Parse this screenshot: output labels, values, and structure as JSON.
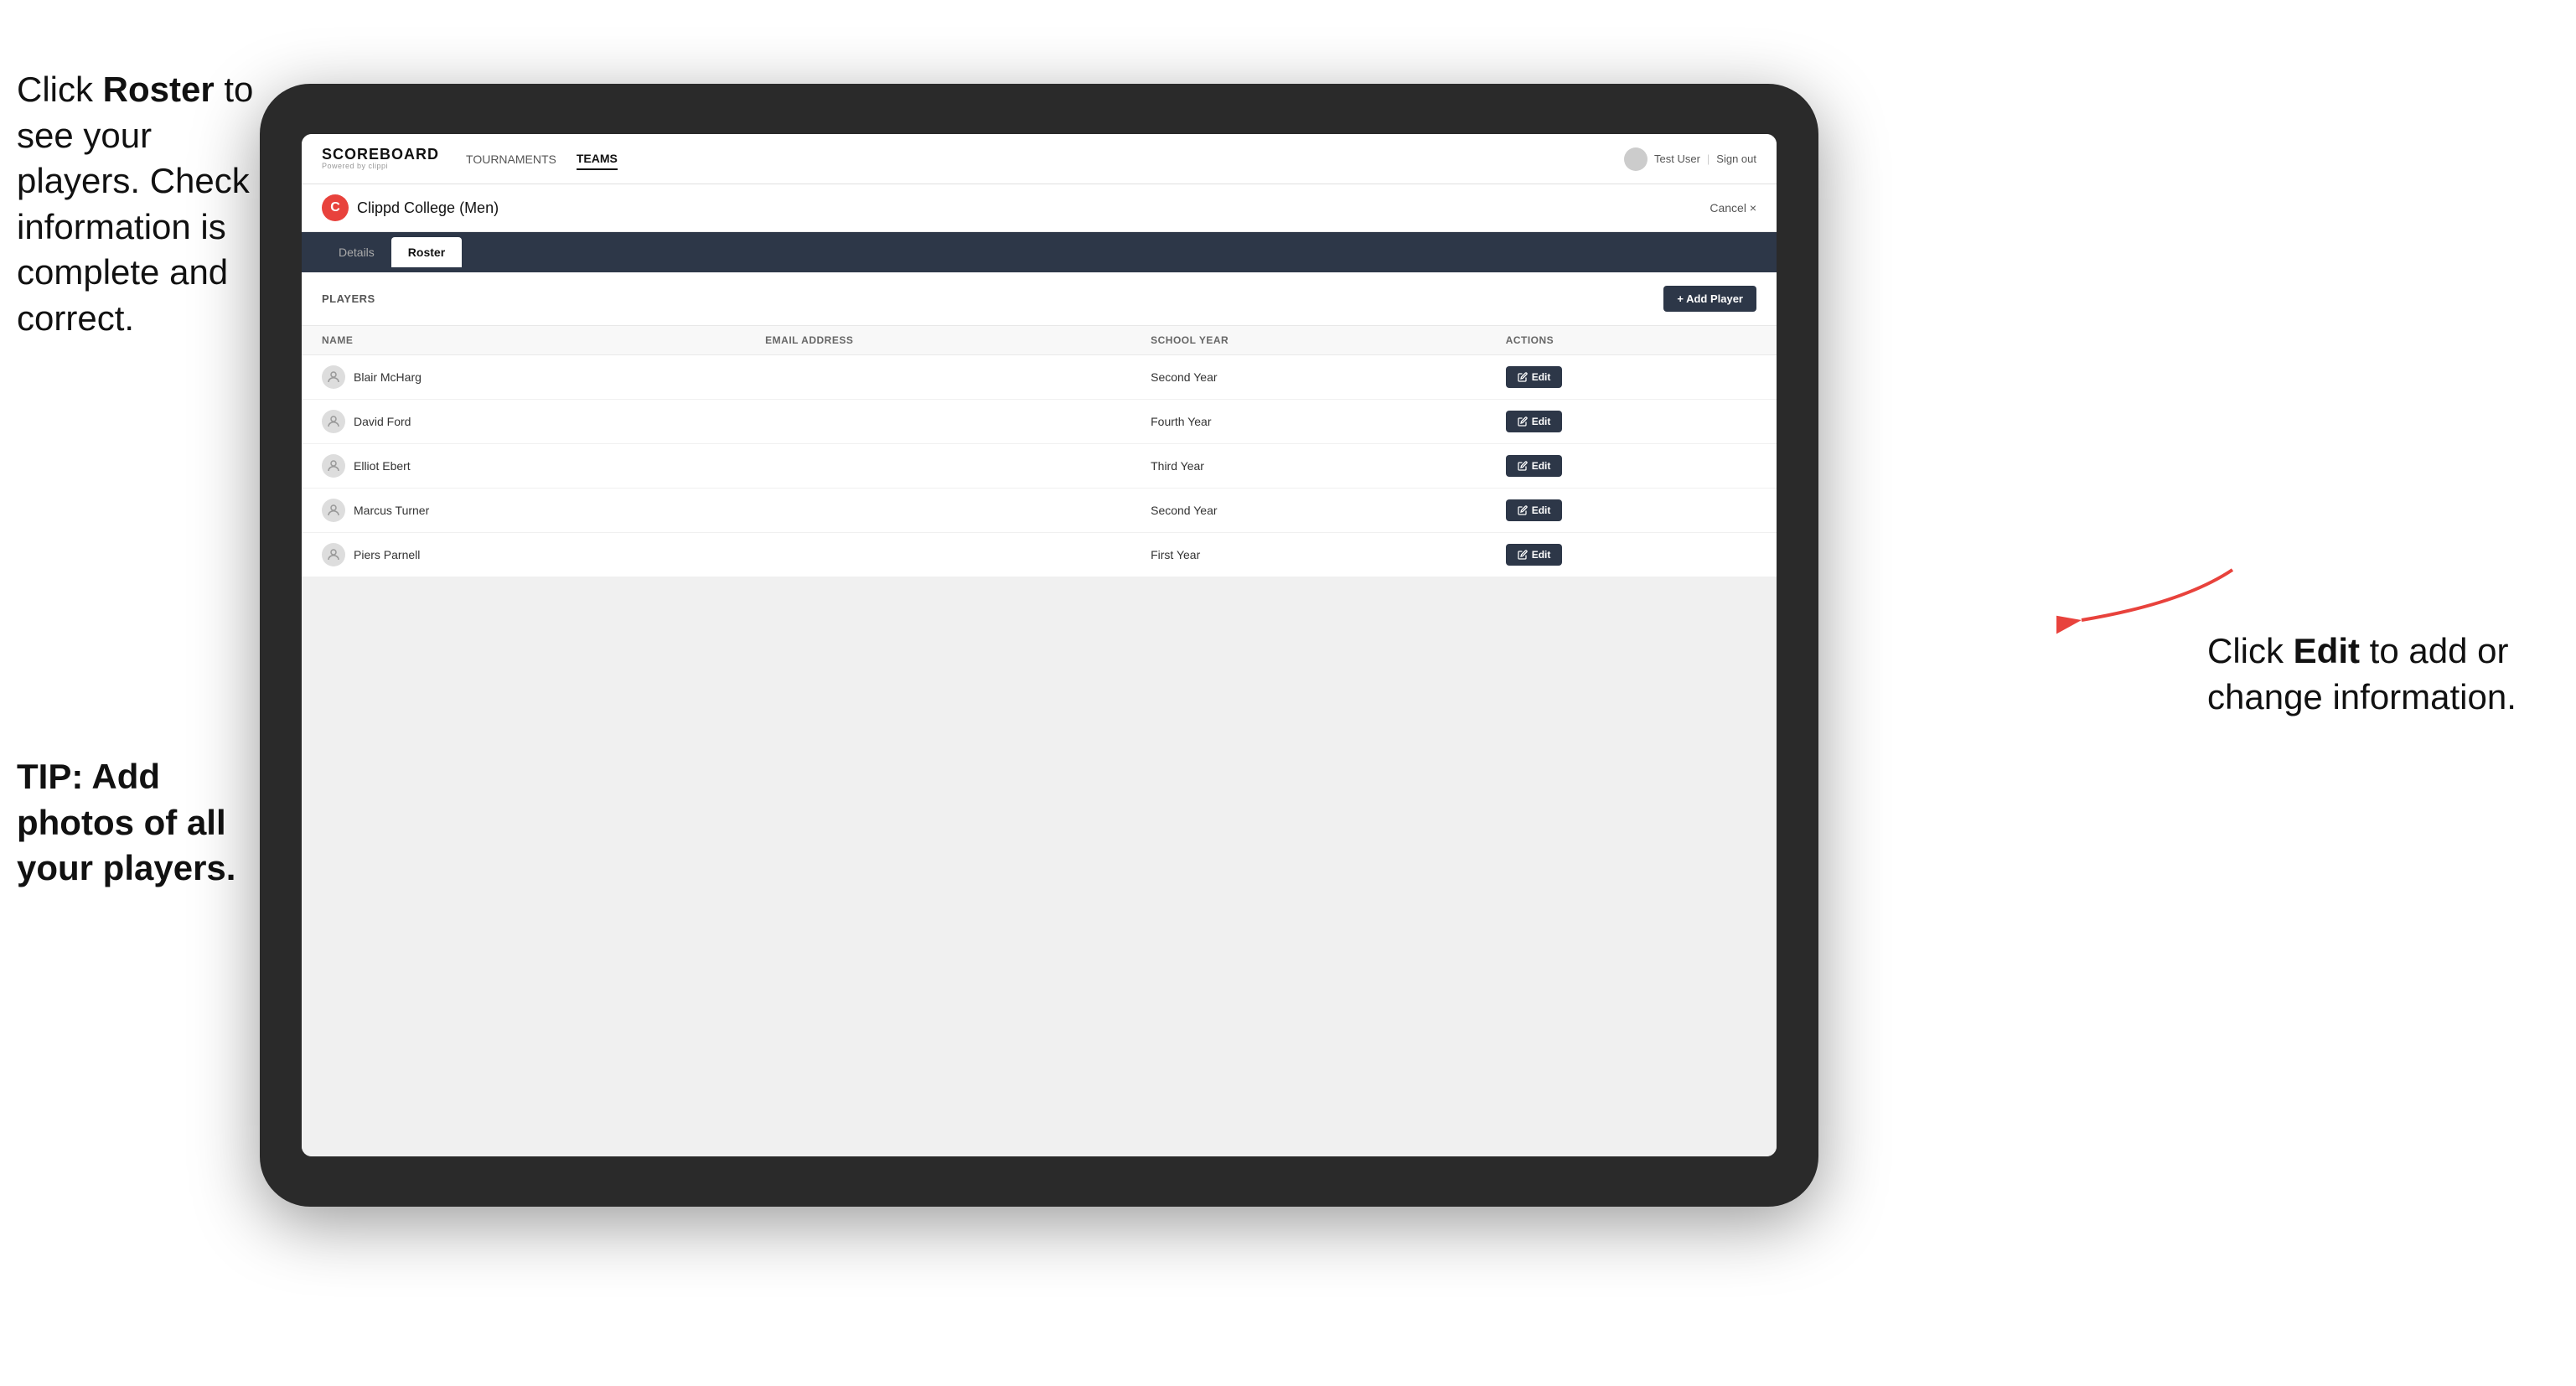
{
  "instructions": {
    "left_line1": "Click ",
    "left_bold": "Roster",
    "left_line2": " to see your players. Check information is complete and correct.",
    "tip": "TIP: Add photos of all your players.",
    "right_line1": "Click ",
    "right_bold": "Edit",
    "right_line2": " to add or change information."
  },
  "navbar": {
    "logo": "SCOREBOARD",
    "logo_sub": "Powered by clippi",
    "nav_items": [
      "TOURNAMENTS",
      "TEAMS"
    ],
    "active_nav": "TEAMS",
    "user": "Test User",
    "sign_out": "Sign out"
  },
  "team": {
    "logo_letter": "C",
    "name": "Clippd College (Men)",
    "cancel_label": "Cancel ×"
  },
  "tabs": [
    {
      "label": "Details",
      "active": false
    },
    {
      "label": "Roster",
      "active": true
    }
  ],
  "players_section": {
    "header_label": "PLAYERS",
    "add_button_label": "+ Add Player"
  },
  "table": {
    "columns": [
      "NAME",
      "EMAIL ADDRESS",
      "SCHOOL YEAR",
      "ACTIONS"
    ],
    "rows": [
      {
        "name": "Blair McHarg",
        "email": "",
        "school_year": "Second Year"
      },
      {
        "name": "David Ford",
        "email": "",
        "school_year": "Fourth Year"
      },
      {
        "name": "Elliot Ebert",
        "email": "",
        "school_year": "Third Year"
      },
      {
        "name": "Marcus Turner",
        "email": "",
        "school_year": "Second Year"
      },
      {
        "name": "Piers Parnell",
        "email": "",
        "school_year": "First Year"
      }
    ],
    "edit_label": "Edit"
  }
}
